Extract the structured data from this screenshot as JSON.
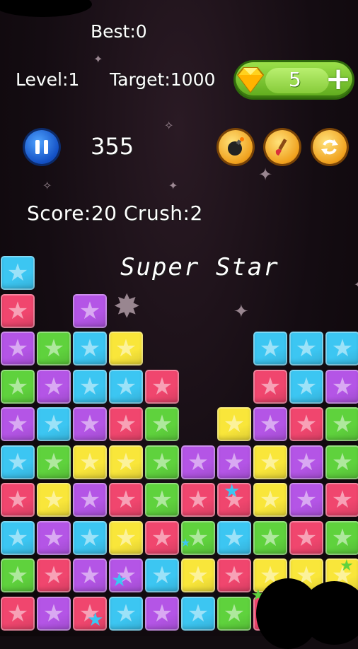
{
  "header": {
    "best": "Best:0",
    "level": "Level:1",
    "target": "Target:1000"
  },
  "gems": {
    "count": "5",
    "plus_label": "+"
  },
  "timer": "355",
  "stats": {
    "score_crush": "Score:20 Crush:2"
  },
  "banner": "Super Star",
  "icons": {
    "pause": "pause-icon",
    "bomb": "bomb-icon",
    "brush": "brush-icon",
    "refresh": "refresh-icon",
    "gem": "diamond-icon",
    "star": "star-icon"
  },
  "colors": {
    "blue": "#3cc6f2",
    "red": "#f0466e",
    "purple": "#b455e6",
    "yellow": "#f9e63a",
    "green": "#5fd23d"
  },
  "board": {
    "columns": 10,
    "cells": [
      {
        "col": 0,
        "row": 0,
        "color": "blue"
      },
      {
        "col": 0,
        "row": 1,
        "color": "red"
      },
      {
        "col": 2,
        "row": 1,
        "color": "purple"
      },
      {
        "col": 0,
        "row": 2,
        "color": "purple"
      },
      {
        "col": 1,
        "row": 2,
        "color": "green"
      },
      {
        "col": 2,
        "row": 2,
        "color": "blue"
      },
      {
        "col": 3,
        "row": 2,
        "color": "yellow"
      },
      {
        "col": 7,
        "row": 2,
        "color": "blue"
      },
      {
        "col": 8,
        "row": 2,
        "color": "blue"
      },
      {
        "col": 9,
        "row": 2,
        "color": "blue"
      },
      {
        "col": 0,
        "row": 3,
        "color": "green"
      },
      {
        "col": 1,
        "row": 3,
        "color": "purple"
      },
      {
        "col": 2,
        "row": 3,
        "color": "blue"
      },
      {
        "col": 3,
        "row": 3,
        "color": "blue"
      },
      {
        "col": 4,
        "row": 3,
        "color": "red"
      },
      {
        "col": 7,
        "row": 3,
        "color": "red"
      },
      {
        "col": 8,
        "row": 3,
        "color": "blue"
      },
      {
        "col": 9,
        "row": 3,
        "color": "purple"
      },
      {
        "col": 0,
        "row": 4,
        "color": "purple"
      },
      {
        "col": 1,
        "row": 4,
        "color": "blue"
      },
      {
        "col": 2,
        "row": 4,
        "color": "purple"
      },
      {
        "col": 3,
        "row": 4,
        "color": "red"
      },
      {
        "col": 4,
        "row": 4,
        "color": "green"
      },
      {
        "col": 6,
        "row": 4,
        "color": "yellow"
      },
      {
        "col": 7,
        "row": 4,
        "color": "purple"
      },
      {
        "col": 8,
        "row": 4,
        "color": "red"
      },
      {
        "col": 9,
        "row": 4,
        "color": "green"
      },
      {
        "col": 0,
        "row": 5,
        "color": "blue"
      },
      {
        "col": 1,
        "row": 5,
        "color": "green"
      },
      {
        "col": 2,
        "row": 5,
        "color": "yellow"
      },
      {
        "col": 3,
        "row": 5,
        "color": "yellow"
      },
      {
        "col": 4,
        "row": 5,
        "color": "green"
      },
      {
        "col": 5,
        "row": 5,
        "color": "purple"
      },
      {
        "col": 6,
        "row": 5,
        "color": "purple"
      },
      {
        "col": 7,
        "row": 5,
        "color": "yellow"
      },
      {
        "col": 8,
        "row": 5,
        "color": "purple"
      },
      {
        "col": 9,
        "row": 5,
        "color": "green"
      },
      {
        "col": 0,
        "row": 6,
        "color": "red"
      },
      {
        "col": 1,
        "row": 6,
        "color": "yellow"
      },
      {
        "col": 2,
        "row": 6,
        "color": "purple"
      },
      {
        "col": 3,
        "row": 6,
        "color": "red"
      },
      {
        "col": 4,
        "row": 6,
        "color": "green"
      },
      {
        "col": 5,
        "row": 6,
        "color": "red"
      },
      {
        "col": 6,
        "row": 6,
        "color": "red"
      },
      {
        "col": 7,
        "row": 6,
        "color": "yellow"
      },
      {
        "col": 8,
        "row": 6,
        "color": "purple"
      },
      {
        "col": 9,
        "row": 6,
        "color": "red"
      },
      {
        "col": 0,
        "row": 7,
        "color": "blue"
      },
      {
        "col": 1,
        "row": 7,
        "color": "purple"
      },
      {
        "col": 2,
        "row": 7,
        "color": "blue"
      },
      {
        "col": 3,
        "row": 7,
        "color": "yellow"
      },
      {
        "col": 4,
        "row": 7,
        "color": "red"
      },
      {
        "col": 5,
        "row": 7,
        "color": "green"
      },
      {
        "col": 6,
        "row": 7,
        "color": "blue"
      },
      {
        "col": 7,
        "row": 7,
        "color": "green"
      },
      {
        "col": 8,
        "row": 7,
        "color": "red"
      },
      {
        "col": 9,
        "row": 7,
        "color": "green"
      },
      {
        "col": 0,
        "row": 8,
        "color": "green"
      },
      {
        "col": 1,
        "row": 8,
        "color": "red"
      },
      {
        "col": 2,
        "row": 8,
        "color": "purple"
      },
      {
        "col": 3,
        "row": 8,
        "color": "purple"
      },
      {
        "col": 4,
        "row": 8,
        "color": "blue"
      },
      {
        "col": 5,
        "row": 8,
        "color": "yellow"
      },
      {
        "col": 6,
        "row": 8,
        "color": "red"
      },
      {
        "col": 7,
        "row": 8,
        "color": "yellow"
      },
      {
        "col": 8,
        "row": 8,
        "color": "yellow"
      },
      {
        "col": 9,
        "row": 8,
        "color": "yellow"
      },
      {
        "col": 0,
        "row": 9,
        "color": "red"
      },
      {
        "col": 1,
        "row": 9,
        "color": "purple"
      },
      {
        "col": 2,
        "row": 9,
        "color": "red"
      },
      {
        "col": 3,
        "row": 9,
        "color": "blue"
      },
      {
        "col": 4,
        "row": 9,
        "color": "purple"
      },
      {
        "col": 5,
        "row": 9,
        "color": "blue"
      },
      {
        "col": 6,
        "row": 9,
        "color": "green"
      },
      {
        "col": 7,
        "row": 9,
        "color": "red"
      }
    ]
  }
}
